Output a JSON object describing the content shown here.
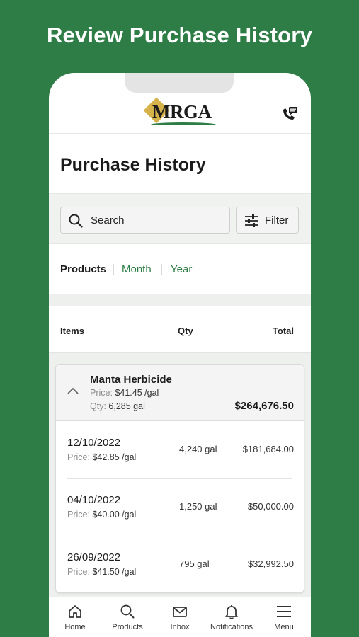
{
  "headline": "Review Purchase History",
  "header": {
    "logo_text": "MRGA",
    "contact_icon": "phone-message-icon"
  },
  "page": {
    "title": "Purchase History"
  },
  "search": {
    "placeholder": "Search",
    "filter_label": "Filter"
  },
  "tabs": [
    {
      "label": "Products",
      "active": true
    },
    {
      "label": "Month",
      "active": false
    },
    {
      "label": "Year",
      "active": false
    }
  ],
  "columns": {
    "items": "Items",
    "qty": "Qty",
    "total": "Total"
  },
  "product": {
    "name": "Manta Herbicide",
    "price_label": "Price:",
    "price_value": "$41.45 /gal",
    "qty_label": "Qty:",
    "qty_value": "6,285 gal",
    "total": "$264,676.50",
    "expanded": true,
    "purchases": [
      {
        "date": "12/10/2022",
        "price_label": "Price:",
        "price_value": "$42.85 /gal",
        "qty": "4,240 gal",
        "total": "$181,684.00"
      },
      {
        "date": "04/10/2022",
        "price_label": "Price:",
        "price_value": "$40.00 /gal",
        "qty": "1,250 gal",
        "total": "$50,000.00"
      },
      {
        "date": "26/09/2022",
        "price_label": "Price:",
        "price_value": "$41.50 /gal",
        "qty": "795 gal",
        "total": "$32,992.50"
      }
    ]
  },
  "nav": [
    {
      "label": "Home",
      "icon": "home-icon"
    },
    {
      "label": "Products",
      "icon": "search-icon"
    },
    {
      "label": "Inbox",
      "icon": "mail-icon"
    },
    {
      "label": "Notifications",
      "icon": "bell-icon"
    },
    {
      "label": "Menu",
      "icon": "menu-icon"
    }
  ],
  "colors": {
    "brand_green": "#2e7d46",
    "logo_gold": "#d6b24a"
  }
}
